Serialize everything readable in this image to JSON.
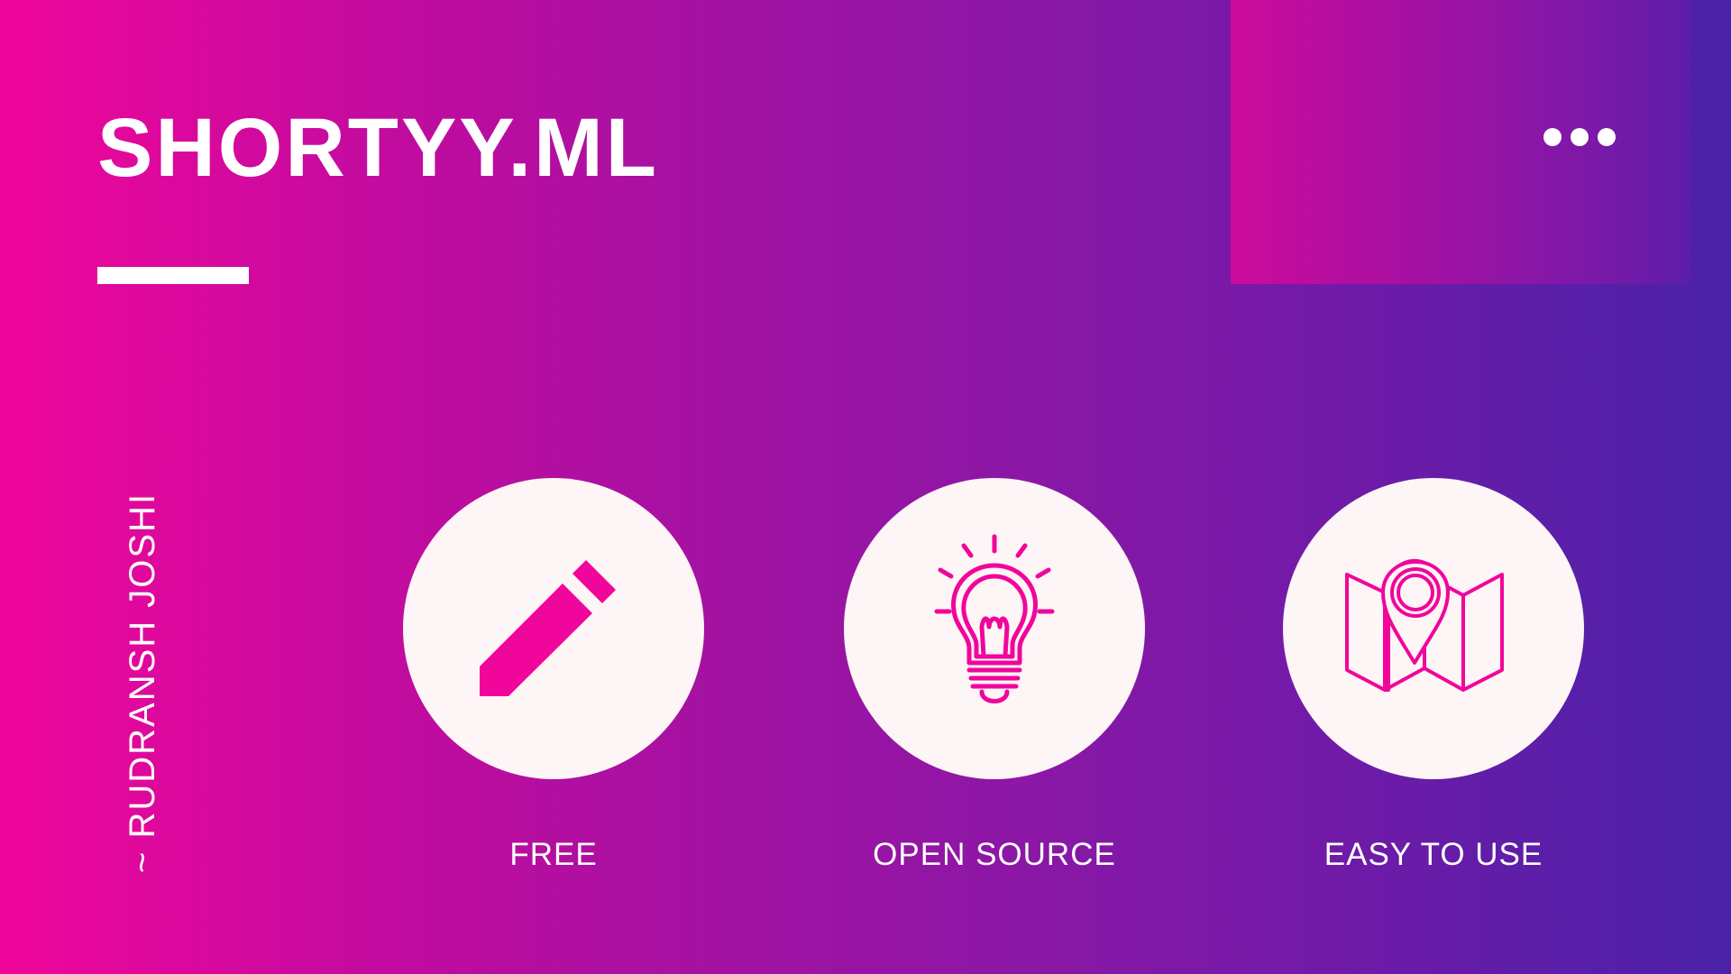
{
  "title": "SHORTYY.ML",
  "author": "~ RUDRANSH JOSHI",
  "menu_icon": "more-dots-icon",
  "colors": {
    "gradient_start": "#f0069b",
    "gradient_end": "#4a22a8",
    "icon_accent": "#f0069b",
    "circle_fill": "#fdf5f6",
    "text": "#ffffff"
  },
  "features": [
    {
      "label": "FREE",
      "icon": "pencil-icon"
    },
    {
      "label": "OPEN SOURCE",
      "icon": "lightbulb-icon"
    },
    {
      "label": "EASY TO USE",
      "icon": "map-pin-icon"
    }
  ]
}
